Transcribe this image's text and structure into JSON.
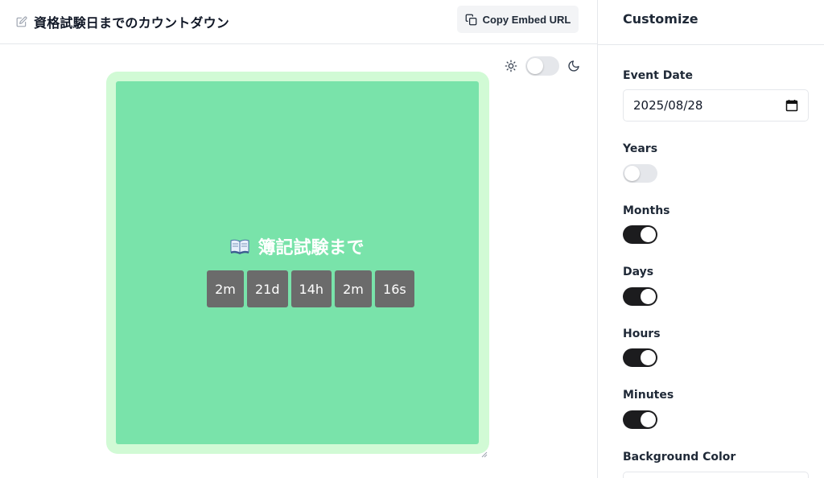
{
  "header": {
    "title": "資格試験日までのカウントダウン",
    "edit_icon": "edit-icon",
    "copy_button_label": "Copy Embed URL",
    "copy_icon": "copy-icon"
  },
  "theme_toggle": {
    "light_icon": "sun-icon",
    "dark_icon": "moon-icon",
    "dark_mode": false
  },
  "widget": {
    "event_icon": "open-book-icon",
    "event_title": "簿記試験まで",
    "countdown": [
      {
        "unit": "months",
        "label": "2m"
      },
      {
        "unit": "days",
        "label": "21d"
      },
      {
        "unit": "hours",
        "label": "14h"
      },
      {
        "unit": "minutes",
        "label": "2m"
      },
      {
        "unit": "seconds",
        "label": "16s"
      }
    ],
    "colors": {
      "frame": "#d1fad5",
      "background": "#79e3aa",
      "tile": "#6b6b6b",
      "text": "#ffffff"
    }
  },
  "sidebar": {
    "title": "Customize",
    "event_date_label": "Event Date",
    "event_date_value": "2025/08/28",
    "toggles": {
      "years": {
        "label": "Years",
        "on": false
      },
      "months": {
        "label": "Months",
        "on": true
      },
      "days": {
        "label": "Days",
        "on": true
      },
      "hours": {
        "label": "Hours",
        "on": true
      },
      "minutes": {
        "label": "Minutes",
        "on": true
      }
    },
    "background_color_label": "Background Color"
  }
}
